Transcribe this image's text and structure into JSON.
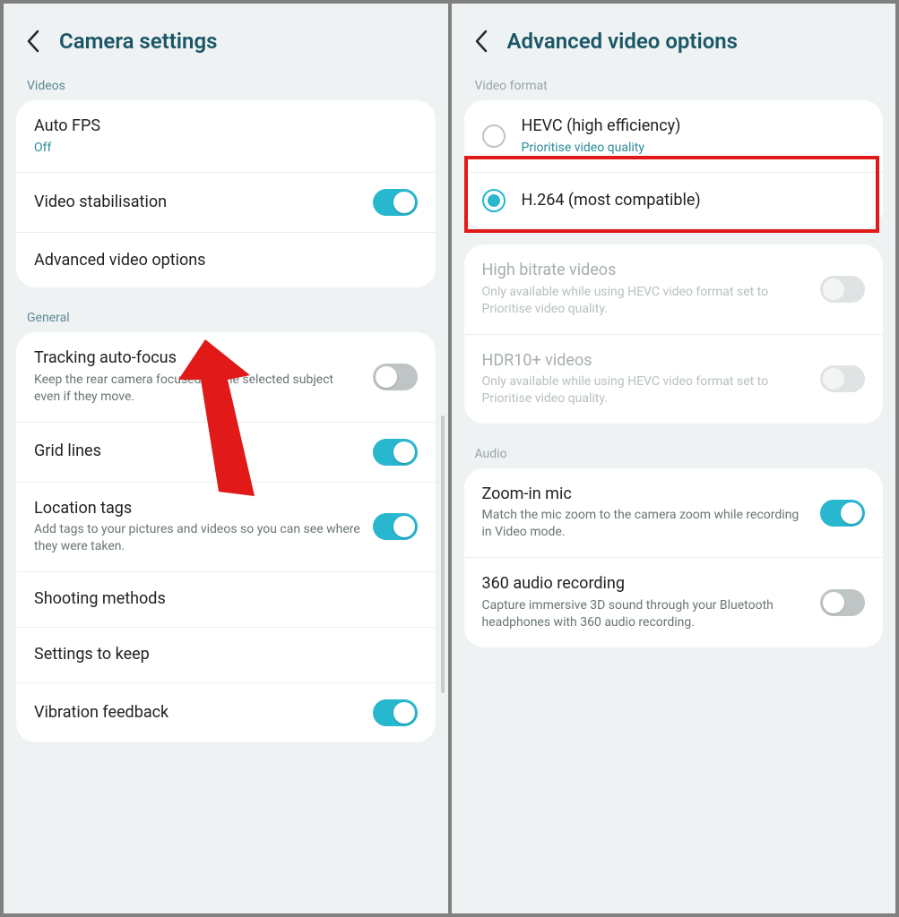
{
  "left": {
    "title": "Camera settings",
    "sections": {
      "videos": {
        "label": "Videos",
        "auto_fps": {
          "title": "Auto FPS",
          "sub": "Off"
        },
        "stabilisation": {
          "title": "Video stabilisation",
          "on": true
        },
        "advanced": {
          "title": "Advanced video options"
        }
      },
      "general": {
        "label": "General",
        "tracking": {
          "title": "Tracking auto-focus",
          "sub": "Keep the rear camera focused on the selected subject even if they move.",
          "on": false
        },
        "grid": {
          "title": "Grid lines",
          "on": true
        },
        "location": {
          "title": "Location tags",
          "sub": "Add tags to your pictures and videos so you can see where they were taken.",
          "on": true
        },
        "shooting": {
          "title": "Shooting methods"
        },
        "keep": {
          "title": "Settings to keep"
        },
        "vibration": {
          "title": "Vibration feedback",
          "on": true
        }
      }
    }
  },
  "right": {
    "title": "Advanced video options",
    "sections": {
      "format": {
        "label": "Video format",
        "hevc": {
          "title": "HEVC (high efficiency)",
          "sub": "Prioritise video quality",
          "selected": false
        },
        "h264": {
          "title": "H.264 (most compatible)",
          "selected": true
        }
      },
      "high_bitrate": {
        "title": "High bitrate videos",
        "sub": "Only available while using HEVC video format set to Prioritise video quality."
      },
      "hdr10": {
        "title": "HDR10+ videos",
        "sub": "Only available while using HEVC video format set to Prioritise video quality."
      },
      "audio": {
        "label": "Audio",
        "zoom_mic": {
          "title": "Zoom-in mic",
          "sub": "Match the mic zoom to the camera zoom while recording in Video mode.",
          "on": true
        },
        "rec360": {
          "title": "360 audio recording",
          "sub": "Capture immersive 3D sound through your Bluetooth headphones with 360 audio recording.",
          "on": false
        }
      }
    }
  }
}
